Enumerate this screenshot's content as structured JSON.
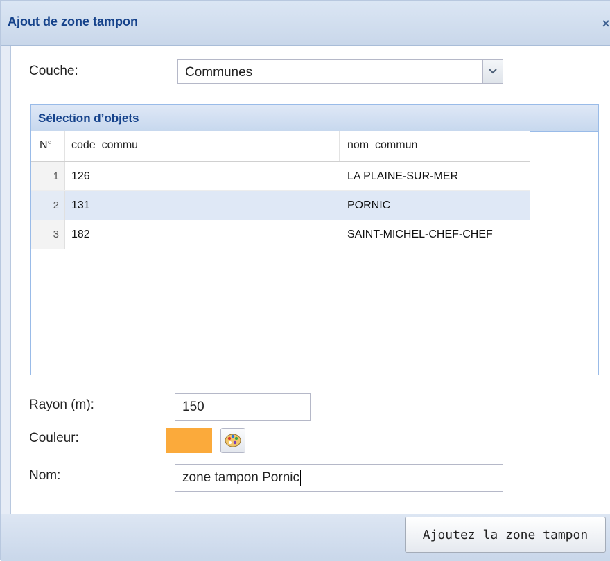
{
  "dialog": {
    "title": "Ajout de zone tampon",
    "close_glyph": "×"
  },
  "layer": {
    "label": "Couche:",
    "value": "Communes"
  },
  "grid": {
    "title": "Sélection d’objets",
    "columns": [
      "N°",
      "code_commu",
      "nom_commun"
    ],
    "rows": [
      {
        "n": "1",
        "code": "126",
        "nom": "LA PLAINE-SUR-MER",
        "selected": false
      },
      {
        "n": "2",
        "code": "131",
        "nom": "PORNIC",
        "selected": true
      },
      {
        "n": "3",
        "code": "182",
        "nom": "SAINT-MICHEL-CHEF-CHEF",
        "selected": false
      }
    ]
  },
  "radius": {
    "label": "Rayon (m):",
    "value": "150"
  },
  "color": {
    "label": "Couleur:",
    "value": "#fbaa3b",
    "picker_icon": "palette-icon"
  },
  "name": {
    "label": "Nom:",
    "value": "zone tampon Pornic"
  },
  "footer": {
    "submit_label": "Ajoutez la zone tampon"
  },
  "colors": {
    "title_text": "#15428b",
    "header_bg": "#c9d7ea",
    "selected_row": "#dfe8f6"
  }
}
